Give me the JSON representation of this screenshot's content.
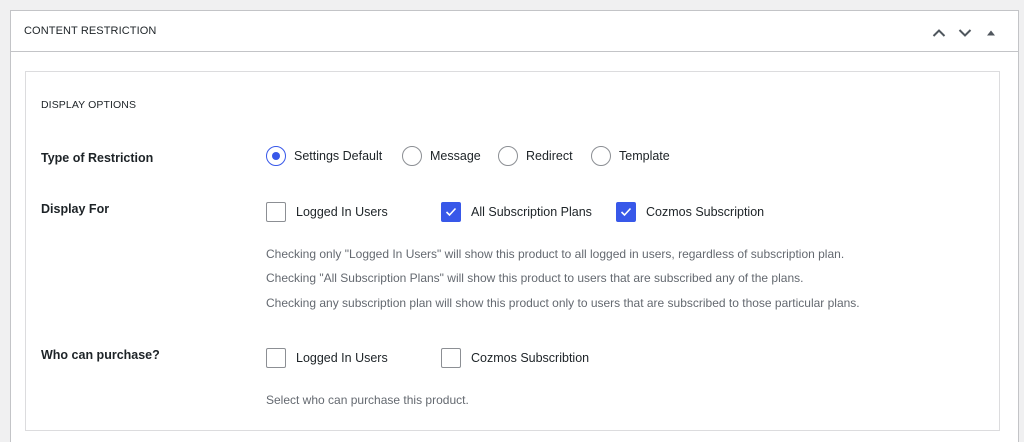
{
  "metabox": {
    "title": "CONTENT RESTRICTION"
  },
  "header_icons": {
    "move_up": "chevron-up-icon",
    "move_down": "chevron-down-icon",
    "toggle": "triangle-up-icon"
  },
  "panel": {
    "section_title": "DISPLAY OPTIONS",
    "type_of_restriction": {
      "label": "Type of Restriction",
      "options": [
        {
          "label": "Settings Default",
          "selected": true
        },
        {
          "label": "Message",
          "selected": false
        },
        {
          "label": "Redirect",
          "selected": false
        },
        {
          "label": "Template",
          "selected": false
        }
      ]
    },
    "display_for": {
      "label": "Display For",
      "options": [
        {
          "label": "Logged In Users",
          "checked": false
        },
        {
          "label": "All Subscription Plans",
          "checked": true
        },
        {
          "label": "Cozmos Subscription",
          "checked": true
        }
      ],
      "help": [
        "Checking only \"Logged In Users\" will show this product to all logged in users, regardless of subscription plan.",
        "Checking \"All Subscription Plans\" will show this product to users that are subscribed any of the plans.",
        "Checking any subscription plan will show this product only to users that are subscribed to those particular plans."
      ]
    },
    "who_can_purchase": {
      "label": "Who can purchase?",
      "options": [
        {
          "label": "Logged In Users",
          "checked": false
        },
        {
          "label": "Cozmos Subscribtion",
          "checked": false
        }
      ],
      "help": "Select who can purchase this product."
    }
  },
  "colors": {
    "accent": "#3858e9",
    "text": "#1d2327",
    "muted": "#646970",
    "border": "#c3c4c7"
  }
}
